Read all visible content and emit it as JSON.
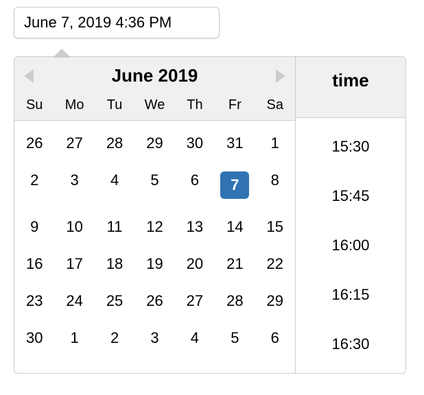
{
  "input": {
    "value": "June 7, 2019 4:36 PM"
  },
  "calendar": {
    "month_label": "June 2019",
    "weekdays": [
      "Su",
      "Mo",
      "Tu",
      "We",
      "Th",
      "Fr",
      "Sa"
    ],
    "days": [
      {
        "n": "26",
        "other": true
      },
      {
        "n": "27",
        "other": true
      },
      {
        "n": "28",
        "other": true
      },
      {
        "n": "29",
        "other": true
      },
      {
        "n": "30",
        "other": true
      },
      {
        "n": "31",
        "other": true
      },
      {
        "n": "1"
      },
      {
        "n": "2"
      },
      {
        "n": "3"
      },
      {
        "n": "4"
      },
      {
        "n": "5"
      },
      {
        "n": "6"
      },
      {
        "n": "7",
        "selected": true
      },
      {
        "n": "8"
      },
      {
        "n": "9"
      },
      {
        "n": "10"
      },
      {
        "n": "11"
      },
      {
        "n": "12"
      },
      {
        "n": "13"
      },
      {
        "n": "14"
      },
      {
        "n": "15"
      },
      {
        "n": "16"
      },
      {
        "n": "17"
      },
      {
        "n": "18"
      },
      {
        "n": "19"
      },
      {
        "n": "20"
      },
      {
        "n": "21"
      },
      {
        "n": "22"
      },
      {
        "n": "23"
      },
      {
        "n": "24"
      },
      {
        "n": "25"
      },
      {
        "n": "26"
      },
      {
        "n": "27"
      },
      {
        "n": "28"
      },
      {
        "n": "29"
      },
      {
        "n": "30"
      },
      {
        "n": "1",
        "other": true
      },
      {
        "n": "2",
        "other": true
      },
      {
        "n": "3",
        "other": true
      },
      {
        "n": "4",
        "other": true
      },
      {
        "n": "5",
        "other": true
      },
      {
        "n": "6",
        "other": true
      }
    ]
  },
  "time": {
    "header": "time",
    "items": [
      "15:30",
      "15:45",
      "16:00",
      "16:15",
      "16:30"
    ]
  },
  "colors": {
    "selected_bg": "#2f73b3"
  }
}
